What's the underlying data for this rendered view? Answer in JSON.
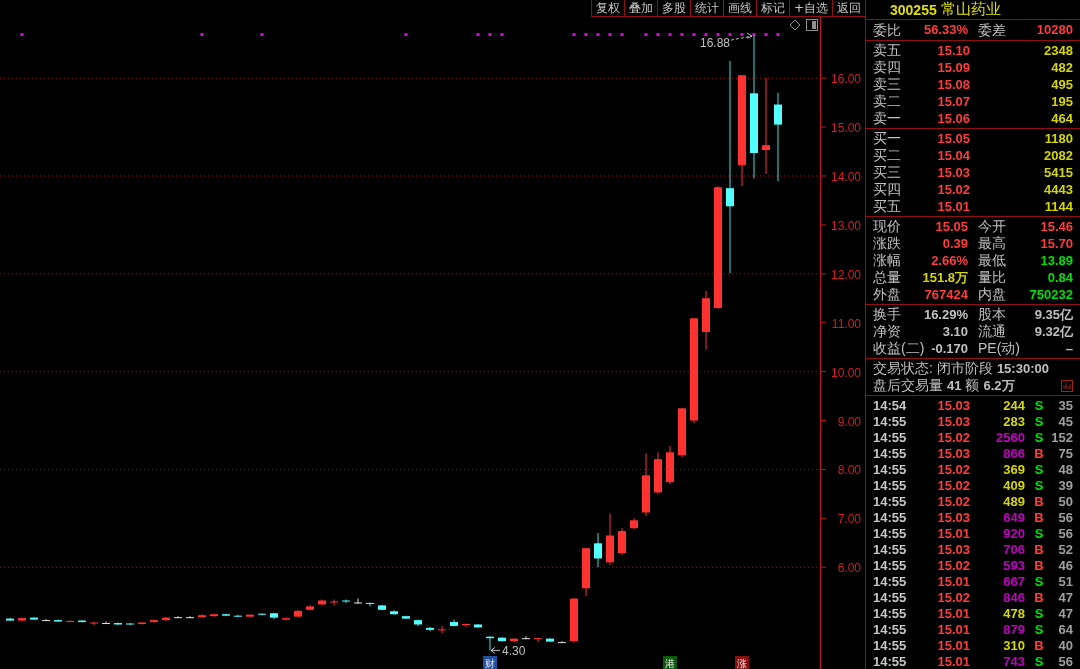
{
  "toolbar": {
    "buttons": [
      "复权",
      "叠加",
      "多股",
      "统计",
      "画线",
      "标记",
      "+自选",
      "返回"
    ]
  },
  "chart": {
    "chart_data": {
      "type": "candlestick",
      "ylim": [
        3.92,
        17.25
      ],
      "yticks": [
        {
          "value": 6,
          "label": "6.00"
        },
        {
          "value": 7,
          "label": "7.00"
        },
        {
          "value": 8,
          "label": "8.00"
        },
        {
          "value": 9,
          "label": "9.00"
        },
        {
          "value": 10,
          "label": "10.00"
        },
        {
          "value": 11,
          "label": "11.00"
        },
        {
          "value": 12,
          "label": "12.00"
        },
        {
          "value": 13,
          "label": "13.00"
        },
        {
          "value": 14,
          "label": "14.00"
        },
        {
          "value": 15,
          "label": "15.00"
        },
        {
          "value": 16,
          "label": "16.00"
        }
      ],
      "categories": [
        null,
        null,
        null,
        null,
        null,
        null,
        null,
        null,
        null,
        null,
        null,
        null,
        null,
        null,
        null,
        null,
        null,
        null,
        null,
        null,
        null,
        null,
        null,
        null,
        null,
        null,
        null,
        null,
        null,
        null,
        null,
        null,
        null,
        null,
        null,
        null,
        null,
        null,
        null,
        null,
        null,
        null,
        null,
        null,
        null,
        null,
        null,
        null,
        null,
        null,
        null,
        null,
        null,
        null,
        null,
        null,
        null,
        null,
        null,
        null,
        null,
        null,
        null,
        null,
        null
      ],
      "ohlc": [
        [
          4.95,
          4.97,
          4.9,
          4.91
        ],
        [
          4.91,
          4.97,
          4.9,
          4.96
        ],
        [
          4.97,
          4.98,
          4.92,
          4.93
        ],
        [
          4.92,
          4.94,
          4.9,
          4.92
        ],
        [
          4.92,
          4.93,
          4.88,
          4.89
        ],
        [
          4.89,
          4.92,
          4.88,
          4.9
        ],
        [
          4.91,
          4.92,
          4.87,
          4.88
        ],
        [
          4.86,
          4.88,
          4.82,
          4.87
        ],
        [
          4.86,
          4.89,
          4.84,
          4.86
        ],
        [
          4.86,
          4.87,
          4.82,
          4.83
        ],
        [
          4.85,
          4.86,
          4.82,
          4.83
        ],
        [
          4.84,
          4.88,
          4.83,
          4.87
        ],
        [
          4.88,
          4.93,
          4.87,
          4.92
        ],
        [
          4.92,
          4.98,
          4.9,
          4.97
        ],
        [
          4.98,
          5.0,
          4.96,
          4.98
        ],
        [
          4.98,
          5.0,
          4.96,
          4.98
        ],
        [
          4.98,
          5.04,
          4.97,
          5.02
        ],
        [
          5.0,
          5.05,
          4.99,
          5.04
        ],
        [
          5.04,
          5.05,
          5.0,
          5.01
        ],
        [
          5.01,
          5.03,
          4.98,
          4.99
        ],
        [
          4.99,
          5.04,
          4.98,
          5.03
        ],
        [
          5.05,
          5.06,
          5.02,
          5.03
        ],
        [
          5.06,
          5.07,
          4.94,
          4.97
        ],
        [
          4.93,
          4.97,
          4.91,
          4.96
        ],
        [
          4.99,
          5.12,
          4.98,
          5.11
        ],
        [
          5.13,
          5.22,
          5.12,
          5.2
        ],
        [
          5.24,
          5.34,
          5.22,
          5.32
        ],
        [
          5.28,
          5.34,
          5.22,
          5.3
        ],
        [
          5.32,
          5.34,
          5.27,
          5.3
        ],
        [
          5.28,
          5.36,
          5.25,
          5.28
        ],
        [
          5.27,
          5.28,
          5.2,
          5.25
        ],
        [
          5.22,
          5.23,
          5.12,
          5.13
        ],
        [
          5.1,
          5.12,
          5.03,
          5.04
        ],
        [
          5.0,
          5.01,
          4.94,
          4.95
        ],
        [
          4.92,
          4.93,
          4.8,
          4.83
        ],
        [
          4.76,
          4.78,
          4.69,
          4.72
        ],
        [
          4.71,
          4.8,
          4.65,
          4.73
        ],
        [
          4.88,
          4.93,
          4.79,
          4.8
        ],
        [
          4.83,
          4.85,
          4.78,
          4.84
        ],
        [
          4.83,
          4.84,
          4.76,
          4.77
        ],
        [
          4.58,
          4.59,
          4.3,
          4.55
        ],
        [
          4.56,
          4.57,
          4.48,
          4.49
        ],
        [
          4.49,
          4.55,
          4.46,
          4.54
        ],
        [
          4.55,
          4.59,
          4.53,
          4.55
        ],
        [
          4.54,
          4.56,
          4.47,
          4.55
        ],
        [
          4.54,
          4.55,
          4.47,
          4.48
        ],
        [
          4.47,
          4.49,
          4.46,
          4.47
        ],
        [
          4.49,
          5.37,
          4.46,
          5.36
        ],
        [
          5.57,
          6.39,
          5.41,
          6.39
        ],
        [
          6.49,
          6.7,
          6.0,
          6.18
        ],
        [
          6.1,
          7.1,
          6.05,
          6.65
        ],
        [
          6.29,
          6.8,
          6.25,
          6.74
        ],
        [
          6.8,
          7.0,
          6.78,
          6.96
        ],
        [
          7.12,
          8.33,
          7.05,
          7.88
        ],
        [
          7.53,
          8.35,
          7.5,
          8.21
        ],
        [
          7.74,
          8.48,
          7.7,
          8.35
        ],
        [
          8.29,
          9.25,
          8.25,
          9.25
        ],
        [
          9.0,
          11.09,
          8.95,
          11.09
        ],
        [
          10.81,
          11.65,
          10.45,
          11.5
        ],
        [
          11.3,
          13.79,
          11.28,
          13.77
        ],
        [
          13.75,
          16.35,
          12.01,
          13.38
        ],
        [
          14.22,
          16.06,
          13.79,
          16.06
        ],
        [
          15.69,
          16.88,
          13.95,
          14.47
        ],
        [
          14.53,
          16.0,
          14.04,
          14.63
        ],
        [
          15.46,
          15.7,
          13.89,
          15.05
        ]
      ],
      "grid": true,
      "annotations": [
        "16.88",
        "4.30"
      ]
    },
    "event_tags": [
      {
        "label": "财",
        "color": "#2050a0"
      },
      {
        "label": "港",
        "color": "#0a5a0a"
      },
      {
        "label": "涨",
        "color": "#8a1010"
      }
    ],
    "signals": [
      false,
      true,
      false,
      false,
      false,
      false,
      false,
      false,
      false,
      false,
      false,
      false,
      false,
      false,
      false,
      false,
      true,
      false,
      false,
      false,
      false,
      true,
      false,
      false,
      false,
      false,
      false,
      false,
      false,
      false,
      false,
      false,
      false,
      true,
      false,
      false,
      false,
      false,
      false,
      true,
      true,
      true,
      false,
      false,
      false,
      false,
      false,
      true,
      true,
      true,
      true,
      true,
      false,
      true,
      true,
      true,
      true,
      true,
      true,
      true,
      true,
      true,
      true,
      true,
      true
    ]
  },
  "quote": {
    "code": "300255",
    "name": "常山药业",
    "order_stats": [
      {
        "label": "委比",
        "value": "56.33%"
      },
      {
        "label": "委差",
        "value": "10280"
      }
    ],
    "asks": [
      {
        "label": "卖五",
        "price": "15.10",
        "volume": "2348"
      },
      {
        "label": "卖四",
        "price": "15.09",
        "volume": "482"
      },
      {
        "label": "卖三",
        "price": "15.08",
        "volume": "495"
      },
      {
        "label": "卖二",
        "price": "15.07",
        "volume": "195"
      },
      {
        "label": "卖一",
        "price": "15.06",
        "volume": "464"
      }
    ],
    "bids": [
      {
        "label": "买一",
        "price": "15.05",
        "volume": "1180"
      },
      {
        "label": "买二",
        "price": "15.04",
        "volume": "2082"
      },
      {
        "label": "买三",
        "price": "15.03",
        "volume": "5415"
      },
      {
        "label": "买四",
        "price": "15.02",
        "volume": "4443"
      },
      {
        "label": "买五",
        "price": "15.01",
        "volume": "1144"
      }
    ],
    "stats": [
      {
        "label": "现价",
        "value": "15.05",
        "color": "#ff3c3c"
      },
      {
        "label": "今开",
        "value": "15.46",
        "color": "#ff3c3c"
      },
      {
        "label": "涨跌",
        "value": "0.39",
        "color": "#ff3c3c"
      },
      {
        "label": "最高",
        "value": "15.70",
        "color": "#ff3c3c"
      },
      {
        "label": "涨幅",
        "value": "2.66%",
        "color": "#ff3c3c"
      },
      {
        "label": "最低",
        "value": "13.89",
        "color": "#00e000"
      },
      {
        "label": "总量",
        "value": "151.8万",
        "color": "#d6d600"
      },
      {
        "label": "量比",
        "value": "0.84",
        "color": "#00e000"
      },
      {
        "label": "外盘",
        "value": "767424",
        "color": "#ff3c3c"
      },
      {
        "label": "内盘",
        "value": "750232",
        "color": "#00e000"
      }
    ],
    "fundamentals": [
      {
        "label": "换手",
        "value": "16.29%"
      },
      {
        "label": "股本",
        "value": "9.35亿"
      },
      {
        "label": "净资",
        "value": "3.10"
      },
      {
        "label": "流通",
        "value": "9.32亿"
      },
      {
        "label": "收益(二)",
        "value": "-0.170"
      },
      {
        "label": "PE(动)",
        "value": "–"
      }
    ],
    "session": {
      "label": "交易状态:",
      "status": "闭市阶段",
      "time": "15:30:00"
    },
    "after_hours": {
      "label": "盘后交易量",
      "volume": "41",
      "amount_label": "额",
      "amount": "6.2万"
    },
    "trades": [
      {
        "time": "14:54",
        "price": "15.03",
        "volume": "244",
        "large": false,
        "side": "S",
        "color": "#00e000",
        "count": "35"
      },
      {
        "time": "14:55",
        "price": "15.03",
        "volume": "283",
        "large": false,
        "side": "S",
        "color": "#00e000",
        "count": "45"
      },
      {
        "time": "14:55",
        "price": "15.02",
        "volume": "2560",
        "large": true,
        "side": "S",
        "color": "#00e000",
        "count": "152"
      },
      {
        "time": "14:55",
        "price": "15.03",
        "volume": "866",
        "large": true,
        "side": "B",
        "color": "#ff3c3c",
        "count": "75"
      },
      {
        "time": "14:55",
        "price": "15.02",
        "volume": "369",
        "large": false,
        "side": "S",
        "color": "#00e000",
        "count": "48"
      },
      {
        "time": "14:55",
        "price": "15.02",
        "volume": "409",
        "large": false,
        "side": "S",
        "color": "#00e000",
        "count": "39"
      },
      {
        "time": "14:55",
        "price": "15.02",
        "volume": "489",
        "large": false,
        "side": "B",
        "color": "#ff3c3c",
        "count": "50"
      },
      {
        "time": "14:55",
        "price": "15.03",
        "volume": "649",
        "large": true,
        "side": "B",
        "color": "#ff3c3c",
        "count": "56"
      },
      {
        "time": "14:55",
        "price": "15.01",
        "volume": "920",
        "large": true,
        "side": "S",
        "color": "#00e000",
        "count": "56"
      },
      {
        "time": "14:55",
        "price": "15.03",
        "volume": "706",
        "large": true,
        "side": "B",
        "color": "#ff3c3c",
        "count": "52"
      },
      {
        "time": "14:55",
        "price": "15.02",
        "volume": "593",
        "large": true,
        "side": "B",
        "color": "#ff3c3c",
        "count": "46"
      },
      {
        "time": "14:55",
        "price": "15.01",
        "volume": "667",
        "large": true,
        "side": "S",
        "color": "#00e000",
        "count": "51"
      },
      {
        "time": "14:55",
        "price": "15.02",
        "volume": "846",
        "large": true,
        "side": "B",
        "color": "#ff3c3c",
        "count": "47"
      },
      {
        "time": "14:55",
        "price": "15.01",
        "volume": "478",
        "large": false,
        "side": "S",
        "color": "#00e000",
        "count": "47"
      },
      {
        "time": "14:55",
        "price": "15.01",
        "volume": "879",
        "large": true,
        "side": "S",
        "color": "#00e000",
        "count": "64"
      },
      {
        "time": "14:55",
        "price": "15.01",
        "volume": "310",
        "large": false,
        "side": "B",
        "color": "#ff3c3c",
        "count": "40"
      },
      {
        "time": "14:55",
        "price": "15.01",
        "volume": "743",
        "large": true,
        "side": "S",
        "color": "#00e000",
        "count": "56"
      }
    ]
  }
}
